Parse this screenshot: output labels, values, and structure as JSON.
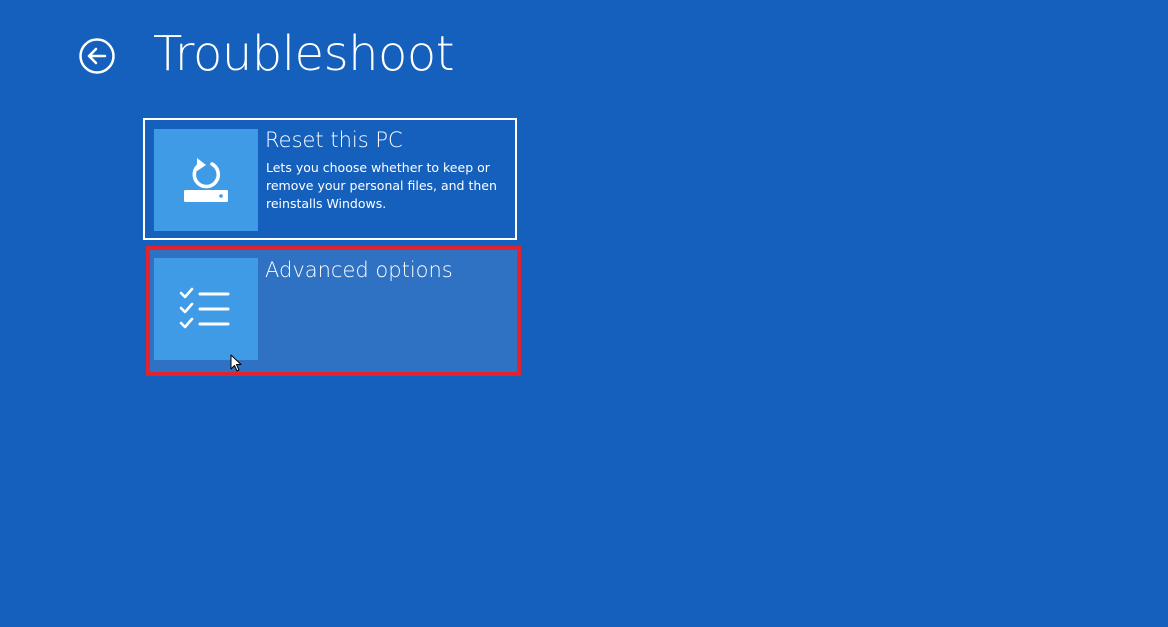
{
  "header": {
    "title": "Troubleshoot",
    "back_icon": "back-arrow-circle-icon"
  },
  "options": {
    "reset": {
      "title": "Reset this PC",
      "description": "Lets you choose whether to keep or remove your personal files, and then reinstalls Windows.",
      "icon": "reset-pc-icon"
    },
    "advanced": {
      "title": "Advanced options",
      "icon": "checklist-icon",
      "highlight_color": "#e3222d"
    }
  },
  "colors": {
    "background": "#1560bd",
    "tile_icon": "#3f9be6",
    "selected_tile": "#2f71c2"
  }
}
